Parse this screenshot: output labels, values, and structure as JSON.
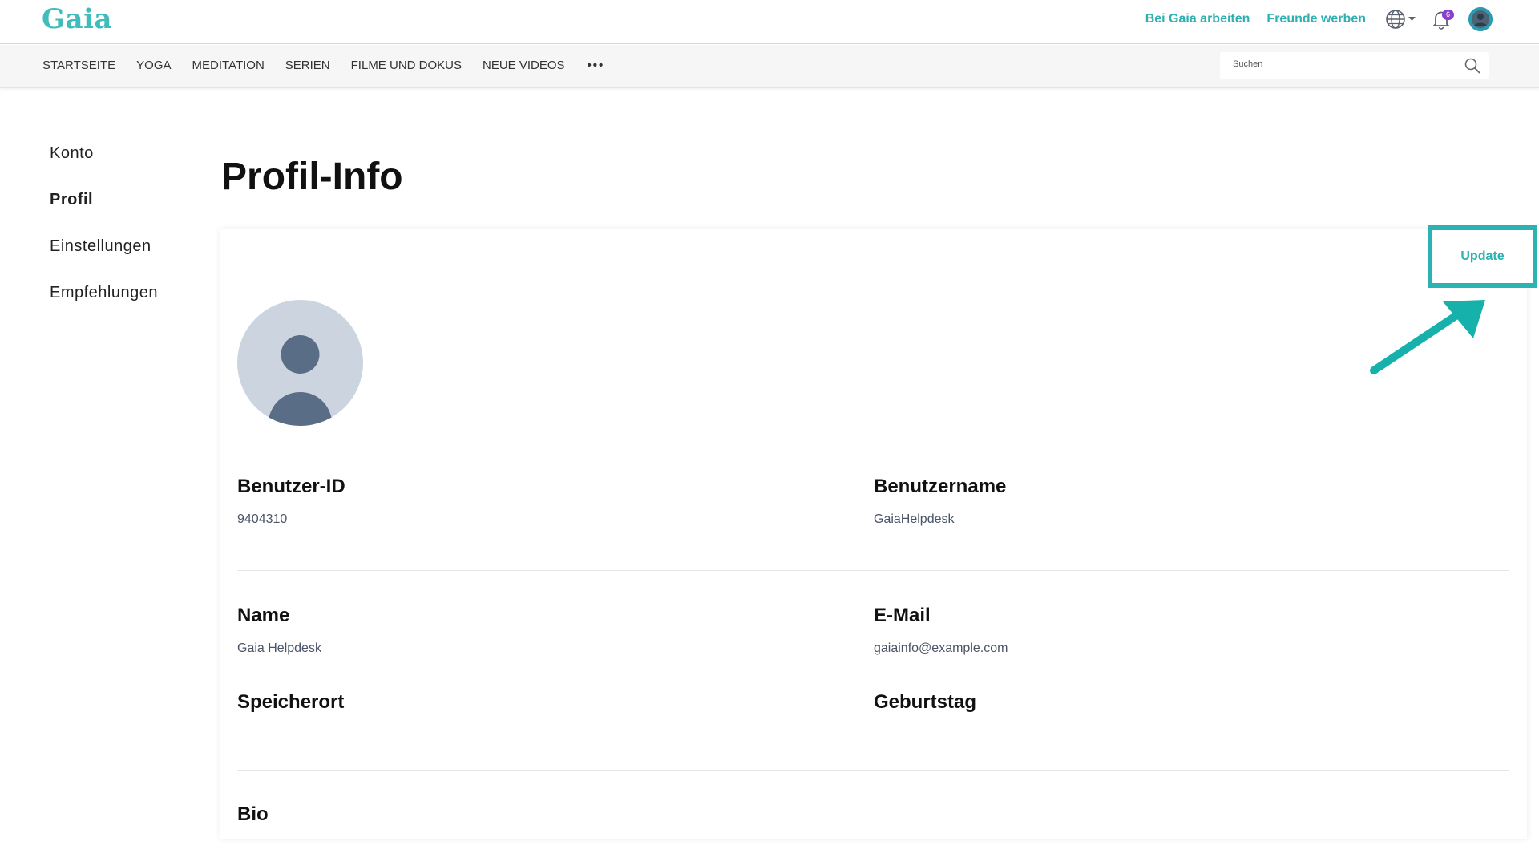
{
  "brand": {
    "logo_text": "Gaia",
    "accent_color": "#2fb0b0"
  },
  "header": {
    "links": [
      "Bei Gaia arbeiten",
      "Freunde werben"
    ],
    "notification_count": "6",
    "icons": [
      "globe-icon",
      "bell-icon",
      "avatar"
    ]
  },
  "nav": {
    "items": [
      "STARTSEITE",
      "YOGA",
      "MEDITATION",
      "SERIEN",
      "FILME UND DOKUS",
      "NEUE VIDEOS"
    ],
    "more_label": "•••",
    "search_placeholder": "Suchen"
  },
  "sidebar": {
    "items": [
      "Konto",
      "Profil",
      "Einstellungen",
      "Empfehlungen"
    ],
    "active": "Profil"
  },
  "main": {
    "title": "Profil-Info",
    "update_label": "Update",
    "fields": {
      "user_id": {
        "label": "Benutzer-ID",
        "value": "9404310"
      },
      "username": {
        "label": "Benutzername",
        "value": "GaiaHelpdesk"
      },
      "name": {
        "label": "Name",
        "value": "Gaia Helpdesk"
      },
      "email": {
        "label": "E-Mail",
        "value": "gaiainfo@example.com"
      },
      "location": {
        "label": "Speicherort",
        "value": ""
      },
      "birthday": {
        "label": "Geburtstag",
        "value": ""
      },
      "bio": {
        "label": "Bio",
        "value": ""
      }
    }
  }
}
